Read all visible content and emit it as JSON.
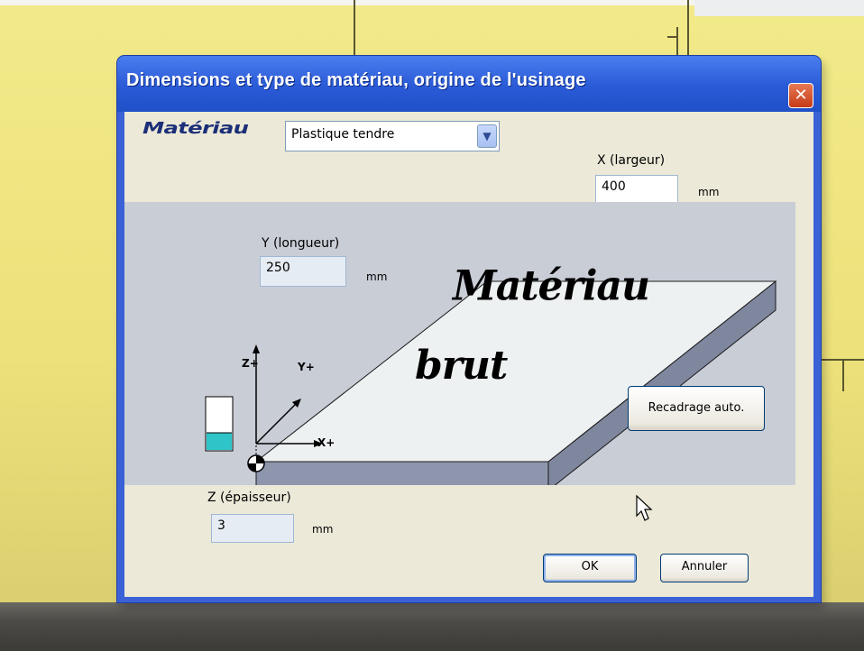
{
  "dialog": {
    "title": "Dimensions et type de matériau, origine de l'usinage",
    "close_label": "✕"
  },
  "material": {
    "label": "Matériau",
    "selected": "Plastique tendre",
    "dropdown_arrow": "▼"
  },
  "x_field": {
    "label": "X (largeur)",
    "value": "400",
    "unit": "mm"
  },
  "y_field": {
    "label": "Y (longueur)",
    "value": "250",
    "unit": "mm"
  },
  "z_field": {
    "label": "Z (épaisseur)",
    "value": "3",
    "unit": "mm"
  },
  "diagram": {
    "text_line1": "Matériau",
    "text_line2": "brut",
    "axis_z": "Z+",
    "axis_y": "Y+",
    "axis_x": "X+",
    "thickness_fill_fraction": 0.33
  },
  "buttons": {
    "recadrage": "Recadrage auto.",
    "ok": "OK",
    "annuler": "Annuler"
  },
  "colors": {
    "title_bar": "#2a5ad6",
    "client": "#ece9d8",
    "panel": "#c9cdd6",
    "thickness_fill": "#2ec4c8"
  }
}
